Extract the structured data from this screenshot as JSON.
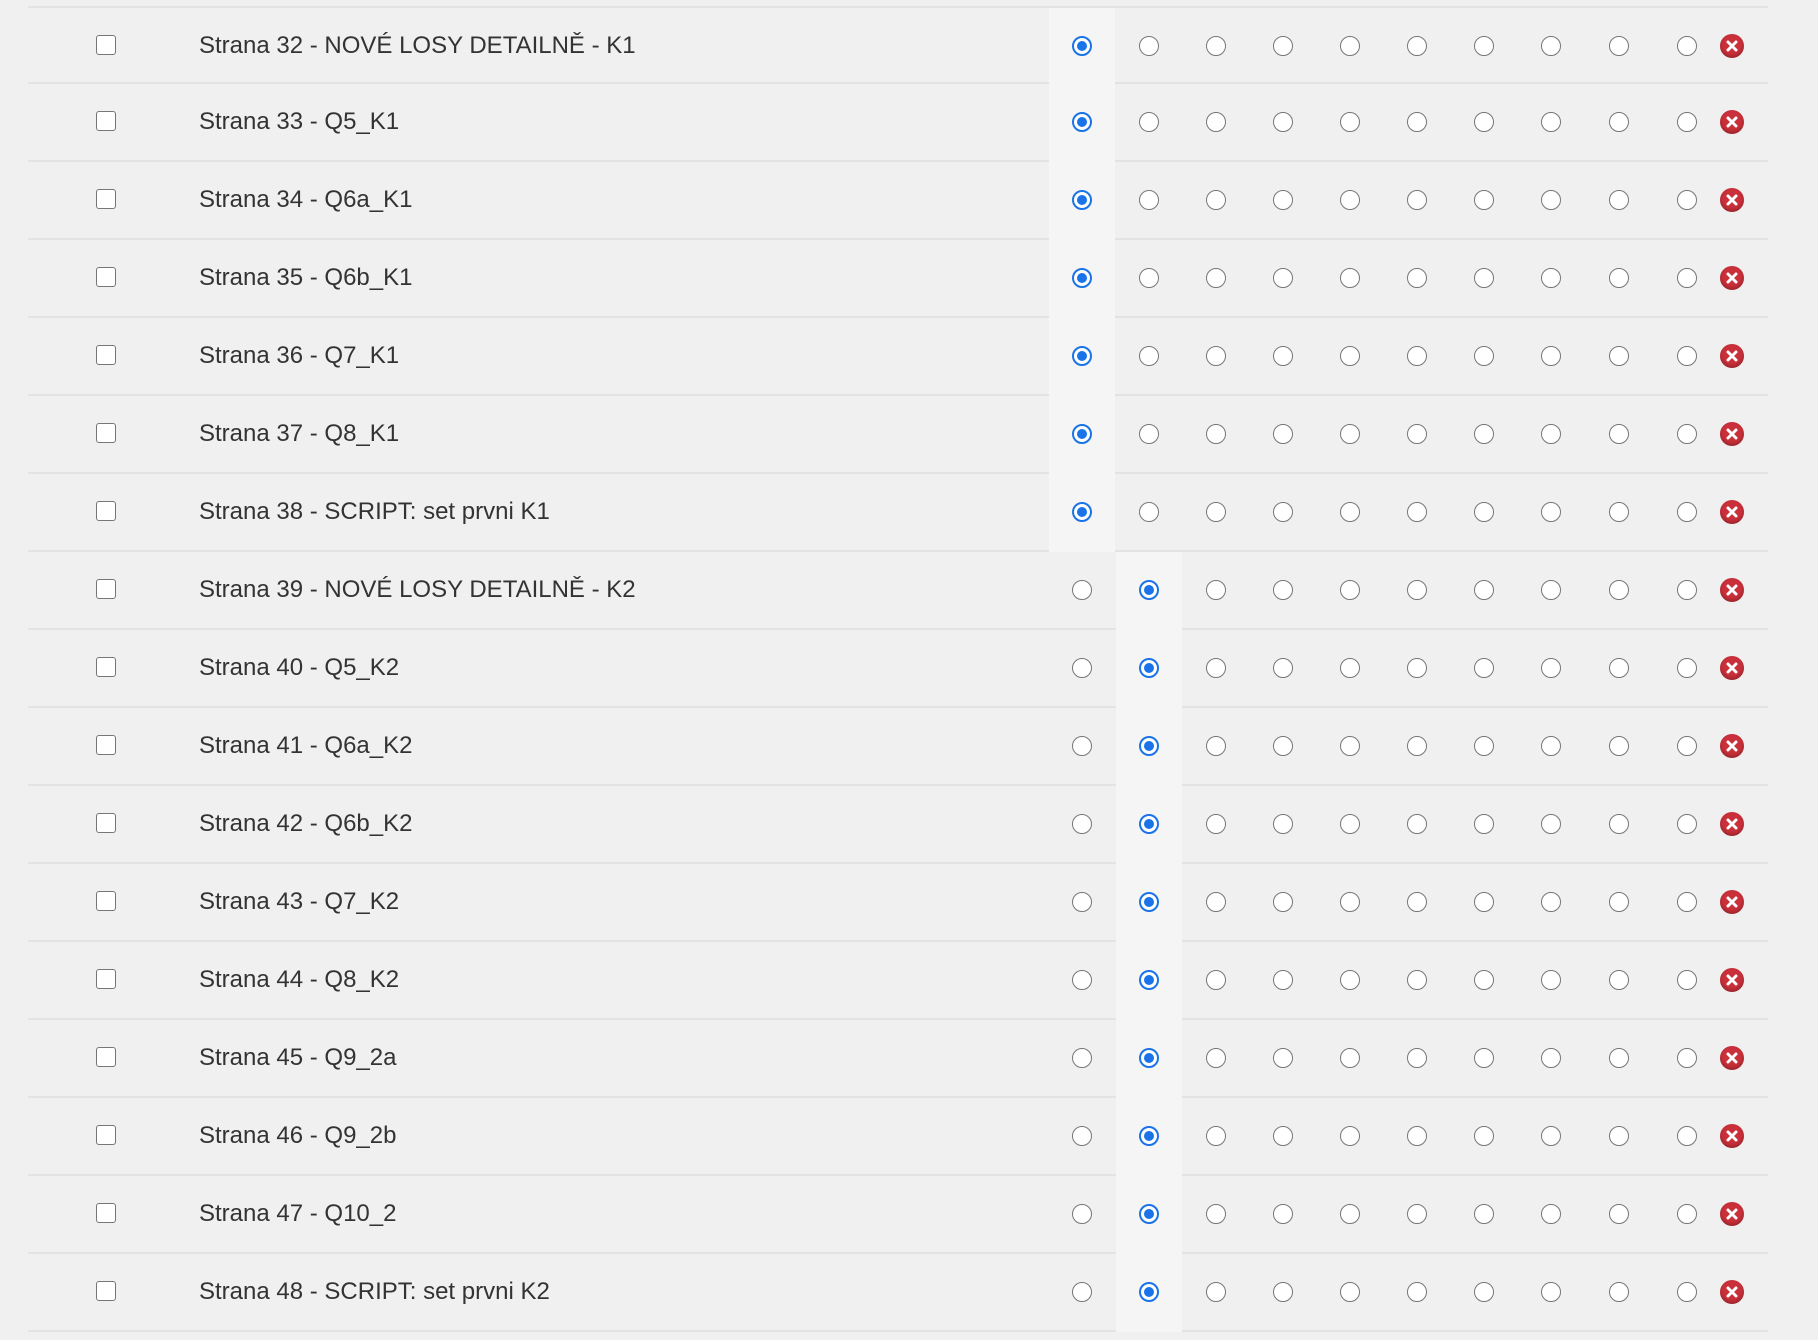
{
  "colors": {
    "accent": "#1a73e8",
    "delete": "#c9303a",
    "background": "#f0f0f0"
  },
  "rows": [
    {
      "label": "Strana 32 - NOVÉ LOSY DETAILNĚ - K1",
      "selected": 0
    },
    {
      "label": "Strana 33 - Q5_K1",
      "selected": 0
    },
    {
      "label": "Strana 34 - Q6a_K1",
      "selected": 0
    },
    {
      "label": "Strana 35 - Q6b_K1",
      "selected": 0
    },
    {
      "label": "Strana 36 - Q7_K1",
      "selected": 0
    },
    {
      "label": "Strana 37 - Q8_K1",
      "selected": 0
    },
    {
      "label": "Strana 38 - SCRIPT: set prvni K1",
      "selected": 0
    },
    {
      "label": "Strana 39 - NOVÉ LOSY DETAILNĚ - K2",
      "selected": 1
    },
    {
      "label": "Strana 40 - Q5_K2",
      "selected": 1
    },
    {
      "label": "Strana 41 - Q6a_K2",
      "selected": 1
    },
    {
      "label": "Strana 42 - Q6b_K2",
      "selected": 1
    },
    {
      "label": "Strana 43 - Q7_K2",
      "selected": 1
    },
    {
      "label": "Strana 44 - Q8_K2",
      "selected": 1
    },
    {
      "label": "Strana 45 - Q9_2a",
      "selected": 1
    },
    {
      "label": "Strana 46 - Q9_2b",
      "selected": 1
    },
    {
      "label": "Strana 47 - Q10_2",
      "selected": 1
    },
    {
      "label": "Strana 48 - SCRIPT: set prvni K2",
      "selected": 1
    }
  ],
  "radio_count": 10,
  "icons": {
    "checkbox": "checkbox-icon",
    "radio": "radio-icon",
    "delete": "delete-icon"
  }
}
